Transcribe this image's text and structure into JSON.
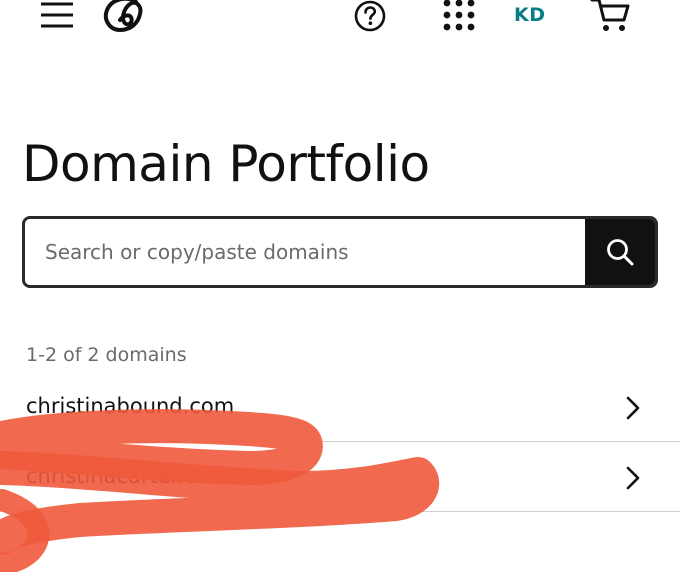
{
  "header": {
    "menu_icon": "hamburger-menu-icon",
    "logo_icon": "godaddy-logo-icon",
    "help_icon": "question-circle-icon",
    "apps_icon": "grid-dots-icon",
    "avatar_initials": "KD",
    "cart_icon": "shopping-cart-icon"
  },
  "page": {
    "title": "Domain Portfolio"
  },
  "search": {
    "placeholder": "Search or copy/paste domains",
    "button_icon": "search-icon"
  },
  "results": {
    "count_text": "1-2 of 2 domains",
    "domains": [
      {
        "name": "christinabound.com",
        "icon": "chevron-right-icon"
      },
      {
        "name": "christinacarter.com",
        "icon": "chevron-right-icon"
      }
    ]
  },
  "colors": {
    "accent": "#0a7e86",
    "text": "#111111",
    "muted": "#6a6a6a",
    "border": "#2a2a2a",
    "divider": "#cfcfcf",
    "search_button_bg": "#111111",
    "marker": "#ef5a3c"
  }
}
